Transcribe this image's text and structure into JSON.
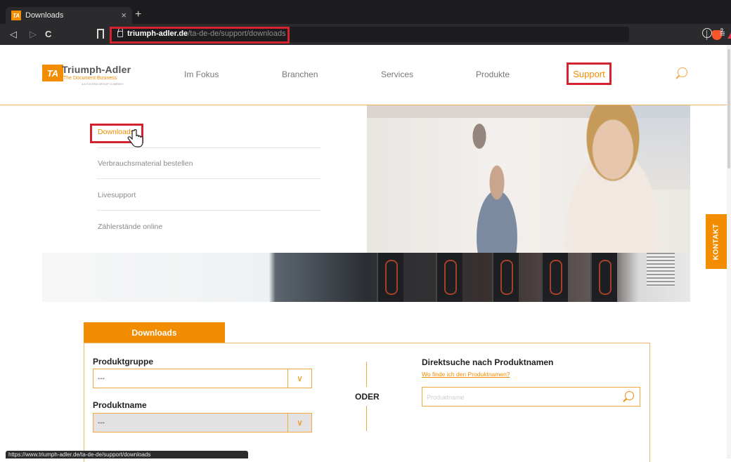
{
  "browser": {
    "tab_title": "Downloads",
    "tab_favicon": "TA",
    "tab_close": "×",
    "new_tab": "+",
    "url_domain": "triumph-adler.de",
    "url_path": "/ta-de-de/support/downloads",
    "shield_count": "9",
    "status_url": "https://www.triumph-adler.de/ta-de-de/support/downloads"
  },
  "header": {
    "logo_mark": "TA",
    "logo_name": "Triumph-Adler",
    "logo_tagline": "The Document Business",
    "logo_group": "A KYOCERA GROUP COMPANY",
    "nav": [
      "Im Fokus",
      "Branchen",
      "Services",
      "Produkte"
    ],
    "support": "Support"
  },
  "dropdown": {
    "items": [
      "Downloads",
      "Verbrauchsmaterial bestellen",
      "Livesupport",
      "Zählerstände online"
    ]
  },
  "kontakt": "KONTAKT",
  "downloads": {
    "tab": "Downloads",
    "produktgruppe_label": "Produktgruppe",
    "produktgruppe_value": "---",
    "produktname_label": "Produktname",
    "produktname_value": "---",
    "oder": "ODER",
    "direkt_title": "Direktsuche nach Produktnamen",
    "direkt_link": "Wo finde ich den Produktnamen?",
    "search_placeholder": "Produktname"
  }
}
